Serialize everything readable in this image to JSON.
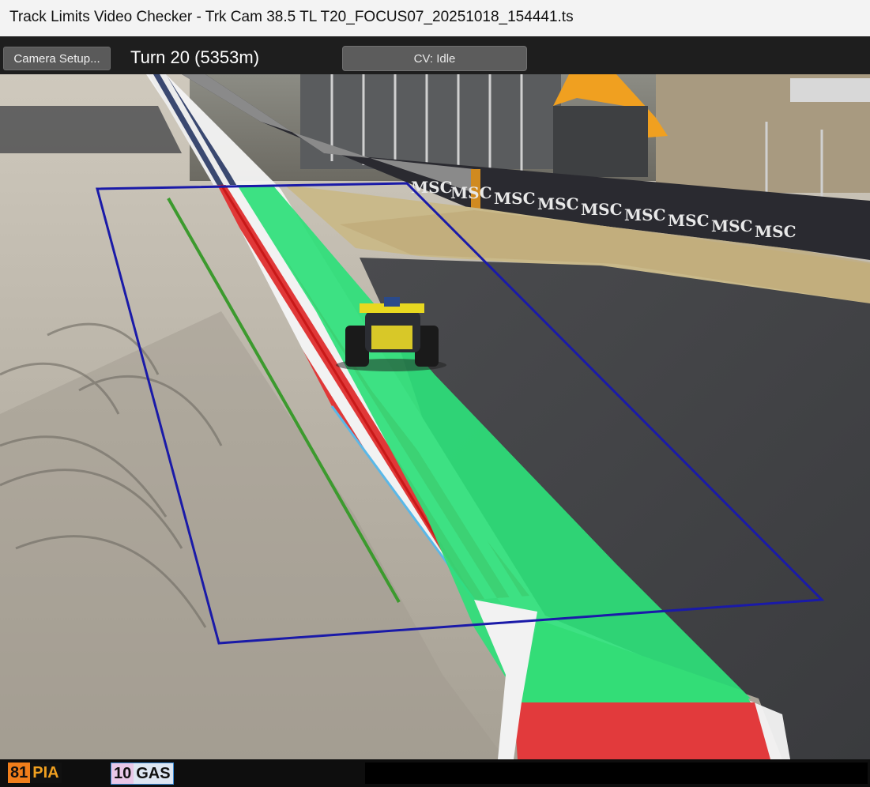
{
  "window": {
    "title": "Track Limits Video Checker - Trk Cam 38.5 TL T20_FOCUS07_20251018_154441.ts"
  },
  "toolbar": {
    "camera_setup_label": "Camera Setup...",
    "turn_label": "Turn 20 (5353m)",
    "cv_status": "CV: Idle"
  },
  "video": {
    "signage": [
      "MSC",
      "MSC",
      "MSC",
      "MSC",
      "MSC",
      "MSC",
      "MSC",
      "MSC",
      "MSC"
    ],
    "detection_zone_color": "#1a1aa8",
    "track_limit_line_color": "#3c9a2e",
    "runoff_highlight_color": "#2ee07a"
  },
  "status_bar": {
    "drivers": [
      {
        "number": "81",
        "abbr": "PIA",
        "num_color": "#f07e1b"
      },
      {
        "number": "10",
        "abbr": "GAS",
        "num_color": "#e8c8e8"
      }
    ]
  }
}
